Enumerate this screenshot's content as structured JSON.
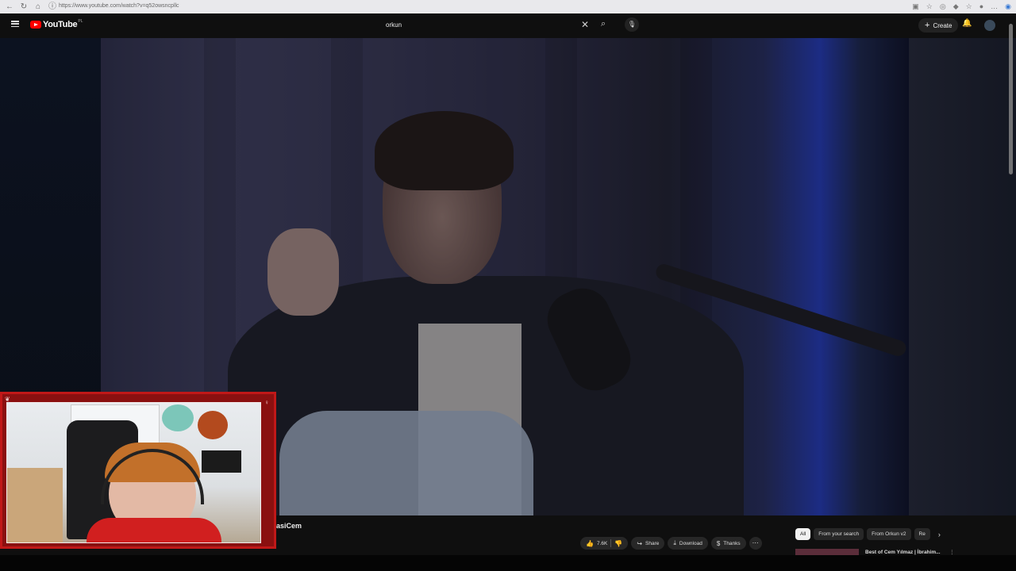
{
  "browser": {
    "url": "https://www.youtube.com/watch?v=q52owsncpllc",
    "nav_icons": [
      "back-icon",
      "forward-icon",
      "refresh-icon",
      "home-icon",
      "site-info-icon"
    ],
    "toolbar_icons": [
      "extensions-icon",
      "favorite-icon",
      "tab-icon",
      "extension-puzzle-icon",
      "favorites-icon",
      "profile-icon",
      "more-icon",
      "edge-copilot-icon"
    ]
  },
  "youtube": {
    "logo_text": "YouTube",
    "logo_country": "PL",
    "search_query": "orkun",
    "create_label": "Create"
  },
  "video": {
    "channel_name": "olukHasiCem",
    "actions": {
      "likes": "7.6K",
      "share": "Share",
      "download": "Download",
      "thanks": "Thanks"
    }
  },
  "recommendations": {
    "chips": [
      "All",
      "From your search",
      "From Orkun v2",
      "Re"
    ],
    "active_chip": "All",
    "first_title": "Best of Cem Yılmaz | İbrahim..."
  },
  "colors": {
    "youtube_red": "#ff0000",
    "page_bg": "#0f0f0f",
    "webcam_border": "#c01818"
  }
}
